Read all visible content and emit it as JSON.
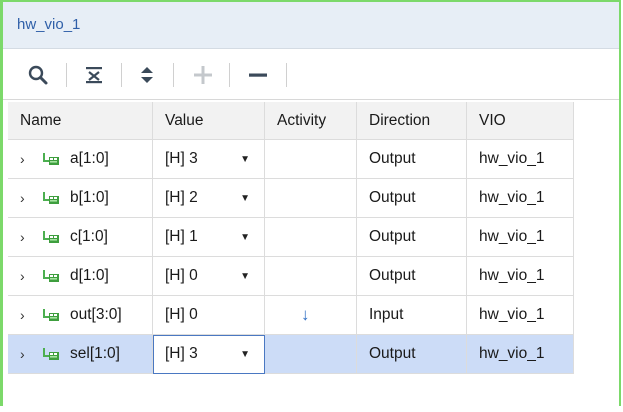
{
  "window": {
    "title": "hw_vio_1"
  },
  "toolbar": {
    "buttons": [
      {
        "icon": "search-icon"
      },
      {
        "icon": "collapse-all-icon"
      },
      {
        "icon": "expand-all-icon"
      },
      {
        "icon": "plus-icon",
        "disabled": true
      },
      {
        "icon": "minus-icon"
      }
    ]
  },
  "table": {
    "headers": [
      "Name",
      "Value",
      "Activity",
      "Direction",
      "VIO"
    ],
    "rows": [
      {
        "name": "a[1:0]",
        "value": "[H] 3",
        "dropdown": true,
        "activity": "",
        "direction": "Output",
        "vio": "hw_vio_1",
        "selected": false
      },
      {
        "name": "b[1:0]",
        "value": "[H] 2",
        "dropdown": true,
        "activity": "",
        "direction": "Output",
        "vio": "hw_vio_1",
        "selected": false
      },
      {
        "name": "c[1:0]",
        "value": "[H] 1",
        "dropdown": true,
        "activity": "",
        "direction": "Output",
        "vio": "hw_vio_1",
        "selected": false
      },
      {
        "name": "d[1:0]",
        "value": "[H] 0",
        "dropdown": true,
        "activity": "",
        "direction": "Output",
        "vio": "hw_vio_1",
        "selected": false
      },
      {
        "name": "out[3:0]",
        "value": "[H] 0",
        "dropdown": false,
        "activity": "↓",
        "direction": "Input",
        "vio": "hw_vio_1",
        "selected": false
      },
      {
        "name": "sel[1:0]",
        "value": "[H] 3",
        "dropdown": true,
        "activity": "",
        "direction": "Output",
        "vio": "hw_vio_1",
        "selected": true
      }
    ]
  },
  "colors": {
    "frame_border": "#7cd96a",
    "title_text": "#2f5fa8",
    "selected_row": "#ccdcf7",
    "activity_arrow": "#2f6fc4"
  }
}
